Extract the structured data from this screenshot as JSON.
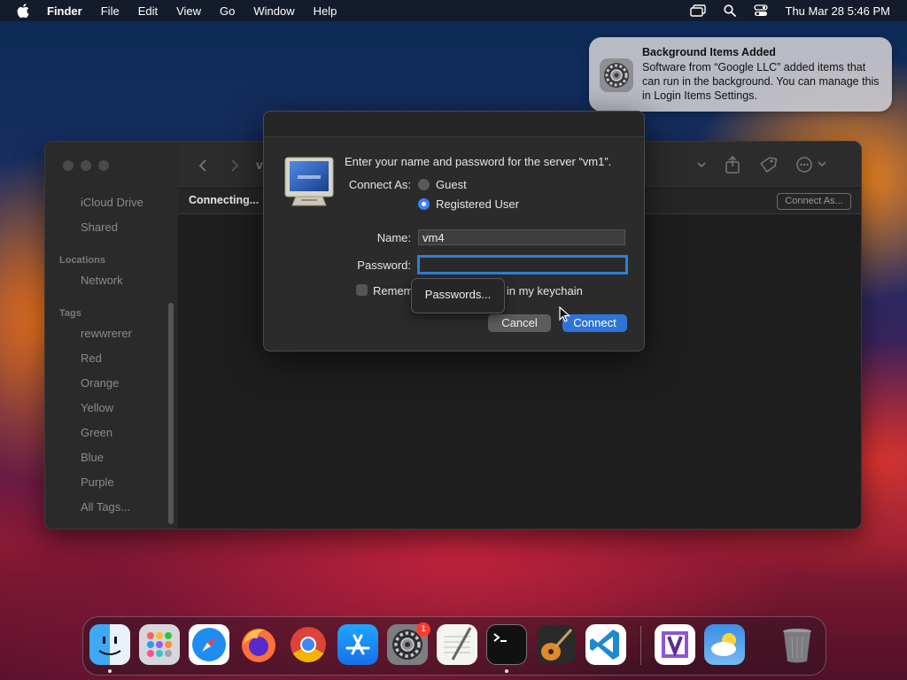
{
  "menubar": {
    "app": "Finder",
    "items": [
      "File",
      "Edit",
      "View",
      "Go",
      "Window",
      "Help"
    ],
    "clock": "Thu Mar 28  5:46 PM"
  },
  "notification": {
    "title": "Background Items Added",
    "body": "Software from “Google LLC” added items that can run in the background. You can manage this in Login Items Settings."
  },
  "finder": {
    "sidebar": {
      "items_top": [
        "iCloud Drive",
        "Shared"
      ],
      "locations_header": "Locations",
      "locations": [
        "Network"
      ],
      "tags_header": "Tags",
      "tags": [
        "rewwrerer",
        "Red",
        "Orange",
        "Yellow",
        "Green",
        "Blue",
        "Purple",
        "All Tags..."
      ]
    },
    "title_partial": "vi",
    "status": "Connecting...",
    "connect_as_button": "Connect As..."
  },
  "dialog": {
    "prompt": "Enter your name and password for the server “vm1”.",
    "connect_as_label": "Connect As:",
    "guest_label": "Guest",
    "registered_label": "Registered User",
    "selected": "Registered User",
    "name_label": "Name:",
    "name_value": "vm4",
    "password_label": "Password:",
    "password_value": "",
    "remember_part1": "Remem",
    "remember_part2": "d in my keychain",
    "cancel_label": "Cancel",
    "connect_label": "Connect"
  },
  "popup": {
    "label": "Passwords..."
  },
  "dock": {
    "apps": [
      "Finder",
      "Launchpad",
      "Safari",
      "Firefox",
      "Chrome",
      "App Store",
      "System Settings",
      "TextEdit",
      "Terminal",
      "GarageBand",
      "Visual Studio Code",
      "Visual Studio",
      "Weather",
      "Trash"
    ],
    "badge_system_settings": "1"
  }
}
